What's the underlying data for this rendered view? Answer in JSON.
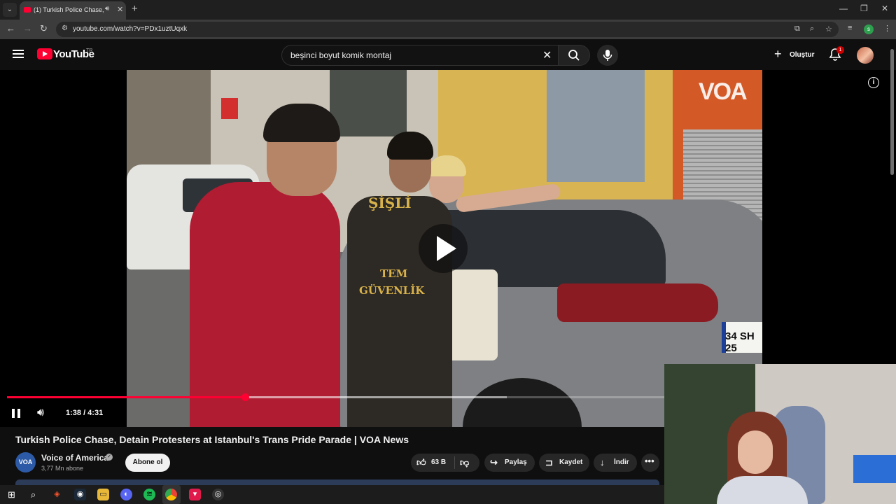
{
  "browser": {
    "tab_title": "(1) Turkish Police Chase, De",
    "url": "youtube.com/watch?v=PDx1uztUqxk",
    "profile_initial": "s"
  },
  "youtube": {
    "logo_text": "YouTube",
    "country_code": "TR",
    "search_query": "beşinci boyut komik montaj",
    "create_label": "Oluştur",
    "notification_count": "1"
  },
  "player": {
    "watermark": "VOA",
    "vest_top": "ŞİŞLİ",
    "vest_mid": "TEM",
    "vest_bottom": "GÜVENLİK",
    "plate": "34 SH 25",
    "current_time": "1:38",
    "duration": "4:31",
    "timecode": "1:38 / 4:31",
    "progress_fraction": 0.362,
    "buffered_fraction": 0.76,
    "state": "paused"
  },
  "video": {
    "title": "Turkish Police Chase, Detain Protesters at Istanbul's Trans Pride Parade | VOA News",
    "channel_name": "Voice of America",
    "channel_avatar_text": "VOA",
    "subscribers": "3,77 Mn abone",
    "subscribe_label": "Abone ol",
    "likes": "63 B",
    "share_label": "Paylaş",
    "save_label": "Kaydet",
    "download_label": "İndir"
  },
  "colors": {
    "accent_red": "#ff0033",
    "background": "#0f0f0f"
  }
}
